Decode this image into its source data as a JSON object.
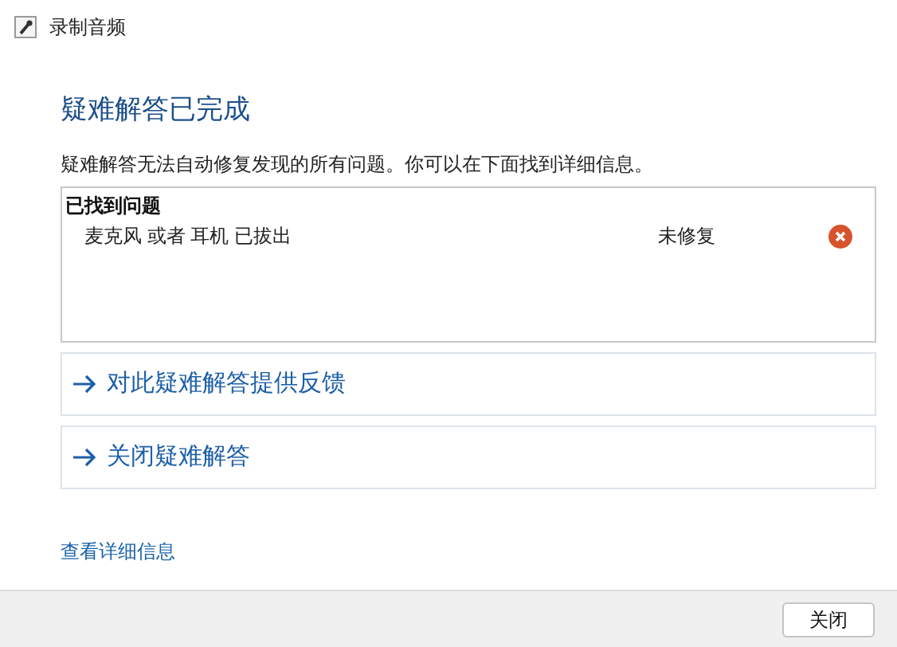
{
  "window": {
    "title": "录制音频"
  },
  "heading": "疑难解答已完成",
  "description": "疑难解答无法自动修复发现的所有问题。你可以在下面找到详细信息。",
  "problems": {
    "title": "已找到问题",
    "items": [
      {
        "name": "麦克风 或者 耳机 已拔出",
        "status": "未修复"
      }
    ]
  },
  "actions": [
    {
      "label": "对此疑难解答提供反馈"
    },
    {
      "label": "关闭疑难解答"
    }
  ],
  "details_link": "查看详细信息",
  "buttons": [
    "关闭"
  ]
}
